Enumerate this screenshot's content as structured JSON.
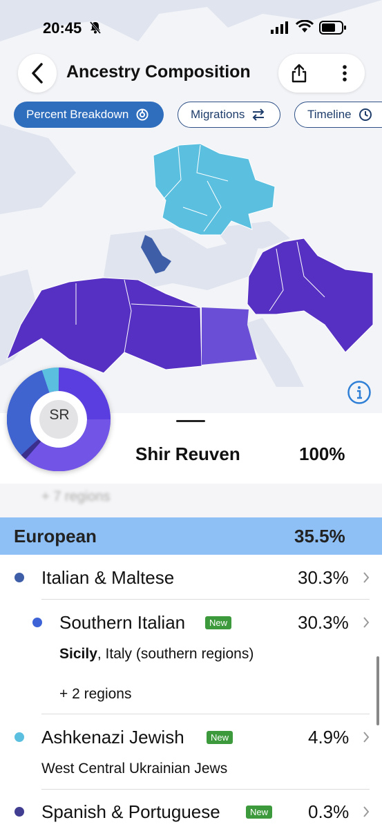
{
  "status": {
    "time": "20:45"
  },
  "header": {
    "title": "Ancestry Composition"
  },
  "tabs": [
    {
      "label": "Percent Breakdown"
    },
    {
      "label": "Migrations"
    },
    {
      "label": "Timeline"
    }
  ],
  "summary": {
    "initials": "SR",
    "name": "Shir Reuven",
    "percent": "100%"
  },
  "hidden_row": {
    "text": "+ 7 regions"
  },
  "group": {
    "name": "European",
    "percent": "35.5%"
  },
  "rows": [
    {
      "label": "Italian & Maltese",
      "percent": "30.3%",
      "dot_color": "#3f5ea8"
    },
    {
      "label": "Southern Italian",
      "badge": "New",
      "percent": "30.3%",
      "dot_color": "#3d63d6",
      "detail_bold": "Sicily",
      "detail_rest": ", Italy (southern regions)",
      "more": "+ 2 regions"
    },
    {
      "label": "Ashkenazi Jewish",
      "badge": "New",
      "percent": "4.9%",
      "dot_color": "#5bbfe0",
      "detail": "West Central Ukrainian Jews"
    },
    {
      "label": "Spanish & Portuguese",
      "badge": "New",
      "percent": "0.3%",
      "dot_color": "#413e91"
    }
  ],
  "colors": {
    "accent": "#2f6dbd",
    "european_header": "#8fc0f5",
    "new_badge": "#3c9a3c",
    "map_light_blue": "#5bbfe0",
    "map_purple": "#6a4fd6",
    "map_dark_purple": "#5630c2"
  }
}
